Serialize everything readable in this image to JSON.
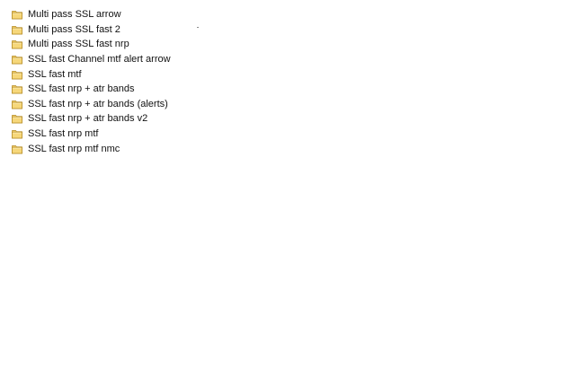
{
  "file_list": {
    "icon": "folder-icon",
    "folder_color": "#e8c25a",
    "items": [
      {
        "label": "Multi pass SSL arrow"
      },
      {
        "label": "Multi pass SSL fast 2"
      },
      {
        "label": "Multi pass SSL fast nrp"
      },
      {
        "label": "SSL fast Channel mtf alert arrow"
      },
      {
        "label": "SSL fast mtf"
      },
      {
        "label": "SSL fast nrp + atr bands"
      },
      {
        "label": "SSL fast nrp + atr bands (alerts)"
      },
      {
        "label": "SSL fast nrp + atr bands v2"
      },
      {
        "label": "SSL fast nrp mtf"
      },
      {
        "label": "SSL fast nrp mtf nmc"
      }
    ]
  }
}
